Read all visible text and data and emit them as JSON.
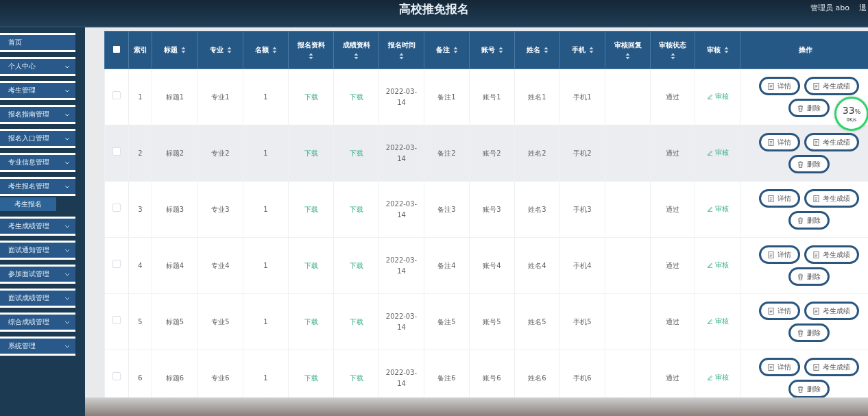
{
  "header": {
    "title": "高校推免报名",
    "user": "管理员 abo",
    "logout": "退"
  },
  "sidebar": {
    "items": [
      {
        "label": "首页",
        "expandable": false
      },
      {
        "label": "个人中心",
        "expandable": true
      },
      {
        "label": "考生管理",
        "expandable": true
      },
      {
        "label": "报名指南管理",
        "expandable": true
      },
      {
        "label": "报名入口管理",
        "expandable": true
      },
      {
        "label": "专业信息管理",
        "expandable": true
      },
      {
        "label": "考生报名管理",
        "expandable": true,
        "children": [
          {
            "label": "考生报名",
            "selected": true
          }
        ]
      },
      {
        "label": "考生成绩管理",
        "expandable": true
      },
      {
        "label": "面试通知管理",
        "expandable": true
      },
      {
        "label": "参加面试管理",
        "expandable": true
      },
      {
        "label": "面试成绩管理",
        "expandable": true
      },
      {
        "label": "综合成绩管理",
        "expandable": true
      },
      {
        "label": "系统管理",
        "expandable": true
      }
    ]
  },
  "table": {
    "select_all": {
      "checked": false
    },
    "columns": [
      {
        "title": "索引",
        "sortable": false,
        "kind": "text"
      },
      {
        "title": "标题",
        "sortable": true,
        "kind": "text"
      },
      {
        "title": "专业",
        "sortable": true,
        "kind": "text"
      },
      {
        "title": "名额",
        "sortable": true,
        "kind": "text"
      },
      {
        "title": "报名资料",
        "sortable": true,
        "kind": "link"
      },
      {
        "title": "成绩资料",
        "sortable": true,
        "kind": "link"
      },
      {
        "title": "报名时间",
        "sortable": true,
        "kind": "text"
      },
      {
        "title": "备注",
        "sortable": true,
        "kind": "text"
      },
      {
        "title": "账号",
        "sortable": true,
        "kind": "text"
      },
      {
        "title": "姓名",
        "sortable": true,
        "kind": "text"
      },
      {
        "title": "手机",
        "sortable": true,
        "kind": "text"
      },
      {
        "title": "审核回复",
        "sortable": true,
        "kind": "text"
      },
      {
        "title": "审核状态",
        "sortable": true,
        "kind": "text"
      },
      {
        "title": "审核",
        "sortable": true,
        "kind": "audit"
      }
    ],
    "actions_title": "操作",
    "rows": [
      {
        "selected": false,
        "hovered": false,
        "cells": [
          "1",
          "标题1",
          "专业1",
          "1",
          "下载",
          "下载",
          "2022-03-14",
          "备注1",
          "账号1",
          "姓名1",
          "手机1",
          null,
          "通过",
          "审核"
        ],
        "actions": [
          {
            "label": "详情",
            "kind": "doc"
          },
          {
            "label": "考生成绩",
            "kind": "doc"
          },
          {
            "label": "删除",
            "kind": "delete"
          }
        ]
      },
      {
        "selected": false,
        "hovered": true,
        "cells": [
          "2",
          "标题2",
          "专业2",
          "1",
          "下载",
          "下载",
          "2022-03-14",
          "备注2",
          "账号2",
          "姓名2",
          "手机2",
          null,
          "通过",
          "审核"
        ],
        "actions": [
          {
            "label": "详情",
            "kind": "doc"
          },
          {
            "label": "考生成绩",
            "kind": "doc"
          },
          {
            "label": "删除",
            "kind": "delete"
          }
        ]
      },
      {
        "selected": false,
        "hovered": false,
        "cells": [
          "3",
          "标题3",
          "专业3",
          "1",
          "下载",
          "下载",
          "2022-03-14",
          "备注3",
          "账号3",
          "姓名3",
          "手机3",
          null,
          "通过",
          "审核"
        ],
        "actions": [
          {
            "label": "详情",
            "kind": "doc"
          },
          {
            "label": "考生成绩",
            "kind": "doc"
          },
          {
            "label": "删除",
            "kind": "delete"
          }
        ]
      },
      {
        "selected": false,
        "hovered": false,
        "cells": [
          "4",
          "标题4",
          "专业4",
          "1",
          "下载",
          "下载",
          "2022-03-14",
          "备注4",
          "账号4",
          "姓名4",
          "手机4",
          null,
          "通过",
          "审核"
        ],
        "actions": [
          {
            "label": "详情",
            "kind": "doc"
          },
          {
            "label": "考生成绩",
            "kind": "doc"
          },
          {
            "label": "删除",
            "kind": "delete"
          }
        ]
      },
      {
        "selected": false,
        "hovered": false,
        "cells": [
          "5",
          "标题5",
          "专业5",
          "1",
          "下载",
          "下载",
          "2022-03-14",
          "备注5",
          "账号5",
          "姓名5",
          "手机5",
          null,
          "通过",
          "审核"
        ],
        "actions": [
          {
            "label": "详情",
            "kind": "doc"
          },
          {
            "label": "考生成绩",
            "kind": "doc"
          },
          {
            "label": "删除",
            "kind": "delete"
          }
        ]
      },
      {
        "selected": false,
        "hovered": false,
        "cells": [
          "6",
          "标题6",
          "专业6",
          "1",
          "下载",
          "下载",
          "2022-03-14",
          "备注6",
          "账号6",
          "姓名6",
          "手机6",
          null,
          "通过",
          "审核"
        ],
        "actions": [
          {
            "label": "详情",
            "kind": "doc"
          },
          {
            "label": "考生成绩",
            "kind": "doc"
          },
          {
            "label": "删除",
            "kind": "delete"
          }
        ]
      }
    ]
  },
  "speed_widget": {
    "percent": "33",
    "unit": "%",
    "rate": "0K/s"
  }
}
